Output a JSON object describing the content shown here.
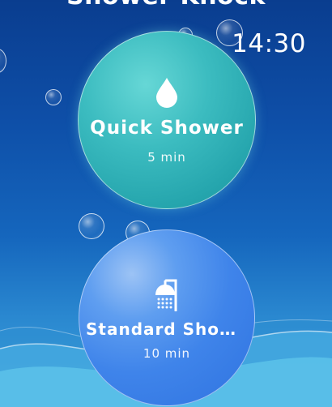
{
  "app": {
    "title": "Shower Knock",
    "time": "14:30"
  },
  "options": [
    {
      "label": "Quick Shower",
      "duration": "5 min",
      "icon": "water-drop-icon",
      "color": "#3cbcc0"
    },
    {
      "label": "Standard Shower",
      "duration": "10 min",
      "icon": "shower-head-icon",
      "color": "#3f84ea"
    }
  ],
  "colors": {
    "background_top": "#0a3d8f",
    "background_bottom": "#3ea3dc",
    "wave": "#5cc2ea"
  }
}
